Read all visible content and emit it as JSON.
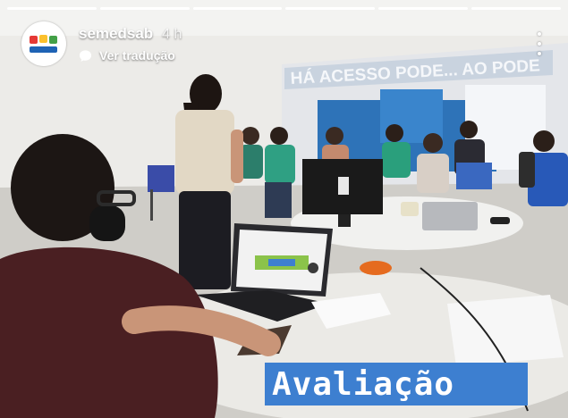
{
  "story": {
    "username": "semedsab",
    "time": "4 h",
    "translate_label": "Ver tradução",
    "segments_total": 6,
    "segments_viewed": 6
  },
  "photo": {
    "banner_text": "HÁ ACESSO PODE... AO PODE",
    "caption_text": "Avaliação"
  },
  "icons": {
    "avatar": "semed-logo-icon",
    "translate": "speech-bubble-icon",
    "more": "more-vertical-icon"
  },
  "colors": {
    "caption_bg": "#3d7fd0",
    "caption_text": "#ffffff",
    "wall": "#eeeeec",
    "blue_wall": "#2e73b8"
  }
}
